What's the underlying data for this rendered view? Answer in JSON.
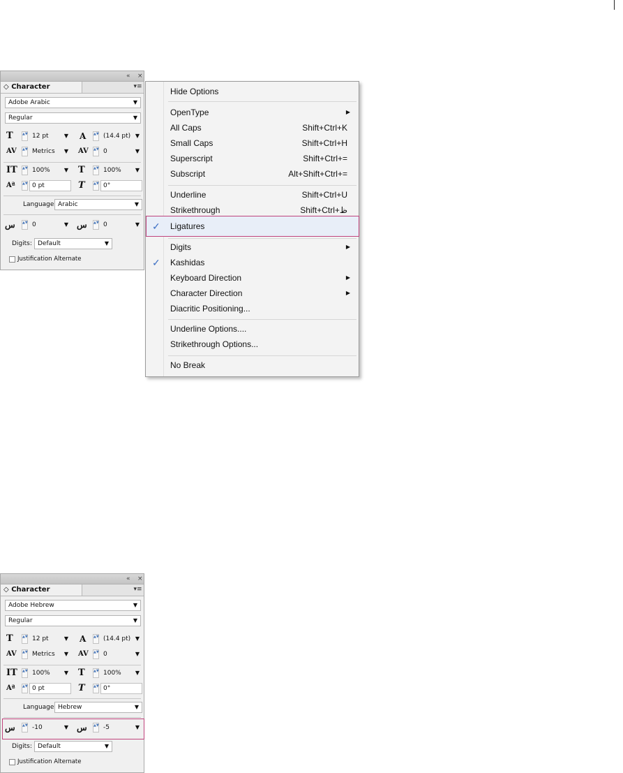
{
  "menu": {
    "items": [
      {
        "label": "Hide Options",
        "shortcut": "",
        "submenu": false,
        "checked": false
      },
      {
        "label": "OpenType",
        "shortcut": "",
        "submenu": true,
        "checked": false
      },
      {
        "label": "All Caps",
        "shortcut": "Shift+Ctrl+K",
        "submenu": false,
        "checked": false
      },
      {
        "label": "Small Caps",
        "shortcut": "Shift+Ctrl+H",
        "submenu": false,
        "checked": false
      },
      {
        "label": "Superscript",
        "shortcut": "Shift+Ctrl+=",
        "submenu": false,
        "checked": false
      },
      {
        "label": "Subscript",
        "shortcut": "Alt+Shift+Ctrl+=",
        "submenu": false,
        "checked": false
      },
      {
        "label": "Underline",
        "shortcut": "Shift+Ctrl+U",
        "submenu": false,
        "checked": false
      },
      {
        "label": "Strikethrough",
        "shortcut": "Shift+Ctrl+ظ",
        "submenu": false,
        "checked": false
      },
      {
        "label": "Ligatures",
        "shortcut": "",
        "submenu": false,
        "checked": true,
        "check_mark": "✓"
      },
      {
        "label": "Digits",
        "shortcut": "",
        "submenu": true,
        "checked": false
      },
      {
        "label": "Kashidas",
        "shortcut": "",
        "submenu": false,
        "checked": true,
        "check_mark": "✓"
      },
      {
        "label": "Keyboard Direction",
        "shortcut": "",
        "submenu": true,
        "checked": false
      },
      {
        "label": "Character Direction",
        "shortcut": "",
        "submenu": true,
        "checked": false
      },
      {
        "label": "Diacritic Positioning...",
        "shortcut": "",
        "submenu": false,
        "checked": false
      },
      {
        "label": "Underline Options....",
        "shortcut": "",
        "submenu": false,
        "checked": false
      },
      {
        "label": "Strikethrough Options...",
        "shortcut": "",
        "submenu": false,
        "checked": false
      },
      {
        "label": "No Break",
        "shortcut": "",
        "submenu": false,
        "checked": false
      }
    ]
  },
  "panels": [
    {
      "title": "Character",
      "font_family": "Adobe Arabic",
      "font_style": "Regular",
      "font_size": "12 pt",
      "leading": "(14.4 pt)",
      "kerning": "Metrics",
      "tracking": "0",
      "vertical_scale": "100%",
      "horizontal_scale": "100%",
      "baseline_shift": "0 pt",
      "skew": "0°",
      "language_label": "Language:",
      "language": "Arabic",
      "diacritic_x": "0",
      "diacritic_y": "0",
      "digits_label": "Digits:",
      "digits": "Default",
      "justification_alternate": "Justification Alternate"
    },
    {
      "title": "Character",
      "font_family": "Adobe Hebrew",
      "font_style": "Regular",
      "font_size": "12 pt",
      "leading": "(14.4 pt)",
      "kerning": "Metrics",
      "tracking": "0",
      "vertical_scale": "100%",
      "horizontal_scale": "100%",
      "baseline_shift": "0 pt",
      "skew": "0°",
      "language_label": "Language:",
      "language": "Hebrew",
      "diacritic_x": "-10",
      "diacritic_y": "-5",
      "digits_label": "Digits:",
      "digits": "Default",
      "justification_alternate": "Justification Alternate"
    }
  ],
  "icons": {
    "collapse": "«",
    "close": "×",
    "panel_menu": "▾≡",
    "panel_tab": "◇",
    "dropdown": "▼",
    "spin": "▲▼",
    "submenu": "▶",
    "font_size_glyph": "T",
    "leading_glyph": "A",
    "kerning_glyph": "AV",
    "vscale_glyph": "IT",
    "hscale_glyph": "T",
    "baseline_glyph": "Aª",
    "skew_glyph": "T",
    "diacritic_glyph": "س"
  },
  "colors": {
    "highlight": "#c0437c",
    "check": "#3c6fc4"
  }
}
